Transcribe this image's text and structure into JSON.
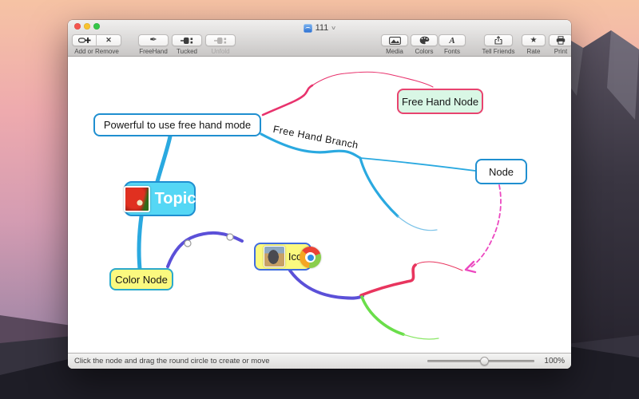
{
  "window": {
    "title": "111",
    "toolbar": {
      "add_remove": {
        "label": "Add or Remove"
      },
      "freehand": {
        "label": "FreeHand"
      },
      "tucked": {
        "label": "Tucked"
      },
      "unfold": {
        "label": "Unfold"
      },
      "media": {
        "label": "Media"
      },
      "colors": {
        "label": "Colors"
      },
      "fonts": {
        "label": "Fonts"
      },
      "tell_friends": {
        "label": "Tell Friends"
      },
      "rate": {
        "label": "Rate"
      },
      "print": {
        "label": "Print"
      }
    },
    "statusbar": {
      "hint": "Click the node and drag the round circle to create or move",
      "zoom_level": "100%"
    }
  },
  "canvas": {
    "nodes": {
      "powerful": {
        "label": "Powerful to use free hand mode"
      },
      "free_hand_node": {
        "label": "Free Hand Node"
      },
      "node": {
        "label": "Node"
      },
      "topic": {
        "label": "Topic"
      },
      "color_node": {
        "label": "Color Node"
      },
      "ico": {
        "label": "Ico"
      }
    },
    "branch_label": "Free Hand Branch",
    "colors": {
      "main_branch": "#2aa9e0",
      "freehand_curve": "#e8336d",
      "purple_branch": "#5b50d8",
      "red_branch": "#e8355e",
      "green_branch": "#6ade4a",
      "dashed_arrow": "#ec48c0",
      "blue_node_border": "#1f8fd0",
      "free_hand_node_bg": "#d9f7e5",
      "free_hand_node_border": "#e8436f",
      "topic_bg": "#55d7f5",
      "yellow_node_bg": "#fbf97f",
      "color_node_border": "#2ba9cc",
      "ico_node_border": "#3f6ce0"
    }
  },
  "icons": {
    "remove_x": "✕",
    "freehand_pen": "✒",
    "rate_star": "★",
    "fonts_a": "A",
    "title_chevron": "∨"
  }
}
